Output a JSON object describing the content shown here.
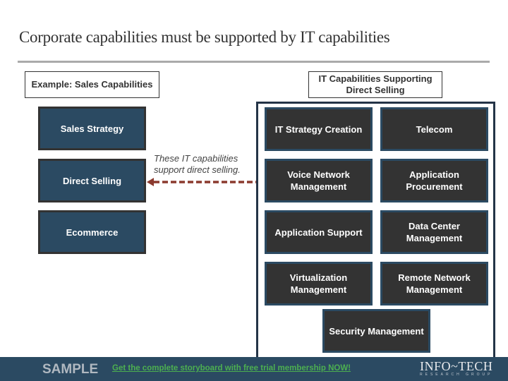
{
  "title": "Corporate capabilities must be supported by IT capabilities",
  "left_label": "Example: Sales Capabilities",
  "right_label": "IT Capabilities Supporting Direct Selling",
  "sales_capabilities": [
    "Sales Strategy",
    "Direct Selling",
    "Ecommerce"
  ],
  "it_capabilities": [
    "IT Strategy Creation",
    "Telecom",
    "Voice Network Management",
    "Application Procurement",
    "Application Support",
    "Data Center Management",
    "Virtualization Management",
    "Remote Network Management",
    "Security Management"
  ],
  "annotation": "These IT capabilities support direct selling.",
  "colors": {
    "sales_box": "#2b4a62",
    "it_box": "#333333",
    "arrow": "#8b3a2e",
    "footer": "#2b4a62",
    "promo_link": "#4caf50"
  },
  "footer": {
    "sample_label": "SAMPLE",
    "promo_text": "Get the complete storyboard with free trial membership NOW!",
    "logo_main": "INFO~TECH",
    "logo_sub": "RESEARCH GROUP"
  }
}
